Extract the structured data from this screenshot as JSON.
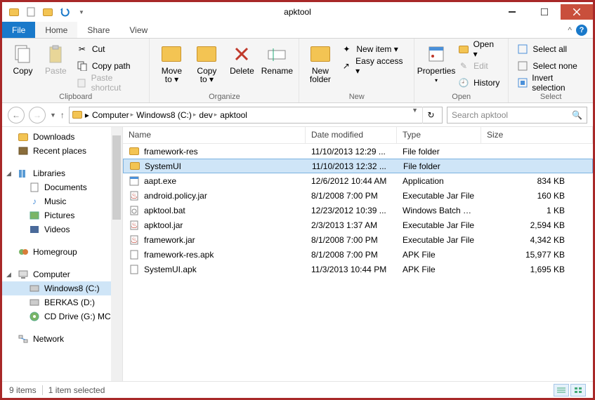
{
  "window": {
    "title": "apktool"
  },
  "tabs": {
    "file": "File",
    "home": "Home",
    "share": "Share",
    "view": "View"
  },
  "ribbon": {
    "clipboard": {
      "label": "Clipboard",
      "copy": "Copy",
      "paste": "Paste",
      "cut": "Cut",
      "copy_path": "Copy path",
      "paste_shortcut": "Paste shortcut"
    },
    "organize": {
      "label": "Organize",
      "move_to": "Move\nto ▾",
      "copy_to": "Copy\nto ▾",
      "delete": "Delete",
      "rename": "Rename"
    },
    "new": {
      "label": "New",
      "new_folder": "New\nfolder",
      "new_item": "New item ▾",
      "easy_access": "Easy access ▾"
    },
    "open": {
      "label": "Open",
      "properties": "Properties",
      "open": "Open ▾",
      "edit": "Edit",
      "history": "History"
    },
    "select": {
      "label": "Select",
      "select_all": "Select all",
      "select_none": "Select none",
      "invert": "Invert selection"
    }
  },
  "breadcrumbs": [
    "Computer",
    "Windows8 (C:)",
    "dev",
    "apktool"
  ],
  "search": {
    "placeholder": "Search apktool"
  },
  "sidebar": {
    "downloads": "Downloads",
    "recent": "Recent places",
    "libraries": "Libraries",
    "documents": "Documents",
    "music": "Music",
    "pictures": "Pictures",
    "videos": "Videos",
    "homegroup": "Homegroup",
    "computer": "Computer",
    "win8": "Windows8 (C:)",
    "berkas": "BERKAS (D:)",
    "cd": "CD Drive (G:) MC",
    "network": "Network"
  },
  "columns": {
    "name": "Name",
    "date": "Date modified",
    "type": "Type",
    "size": "Size"
  },
  "files": [
    {
      "name": "framework-res",
      "date": "11/10/2013 12:29 ...",
      "type": "File folder",
      "size": "",
      "icon": "folder",
      "selected": false
    },
    {
      "name": "SystemUI",
      "date": "11/10/2013 12:32 ...",
      "type": "File folder",
      "size": "",
      "icon": "folder",
      "selected": true
    },
    {
      "name": "aapt.exe",
      "date": "12/6/2012 10:44 AM",
      "type": "Application",
      "size": "834 KB",
      "icon": "exe",
      "selected": false
    },
    {
      "name": "android.policy.jar",
      "date": "8/1/2008 7:00 PM",
      "type": "Executable Jar File",
      "size": "160 KB",
      "icon": "jar",
      "selected": false
    },
    {
      "name": "apktool.bat",
      "date": "12/23/2012 10:39 ...",
      "type": "Windows Batch File",
      "size": "1 KB",
      "icon": "bat",
      "selected": false
    },
    {
      "name": "apktool.jar",
      "date": "2/3/2013 1:37 AM",
      "type": "Executable Jar File",
      "size": "2,594 KB",
      "icon": "jar",
      "selected": false
    },
    {
      "name": "framework.jar",
      "date": "8/1/2008 7:00 PM",
      "type": "Executable Jar File",
      "size": "4,342 KB",
      "icon": "jar",
      "selected": false
    },
    {
      "name": "framework-res.apk",
      "date": "8/1/2008 7:00 PM",
      "type": "APK File",
      "size": "15,977 KB",
      "icon": "file",
      "selected": false
    },
    {
      "name": "SystemUI.apk",
      "date": "11/3/2013 10:44 PM",
      "type": "APK File",
      "size": "1,695 KB",
      "icon": "file",
      "selected": false
    }
  ],
  "status": {
    "items": "9 items",
    "selected": "1 item selected"
  }
}
